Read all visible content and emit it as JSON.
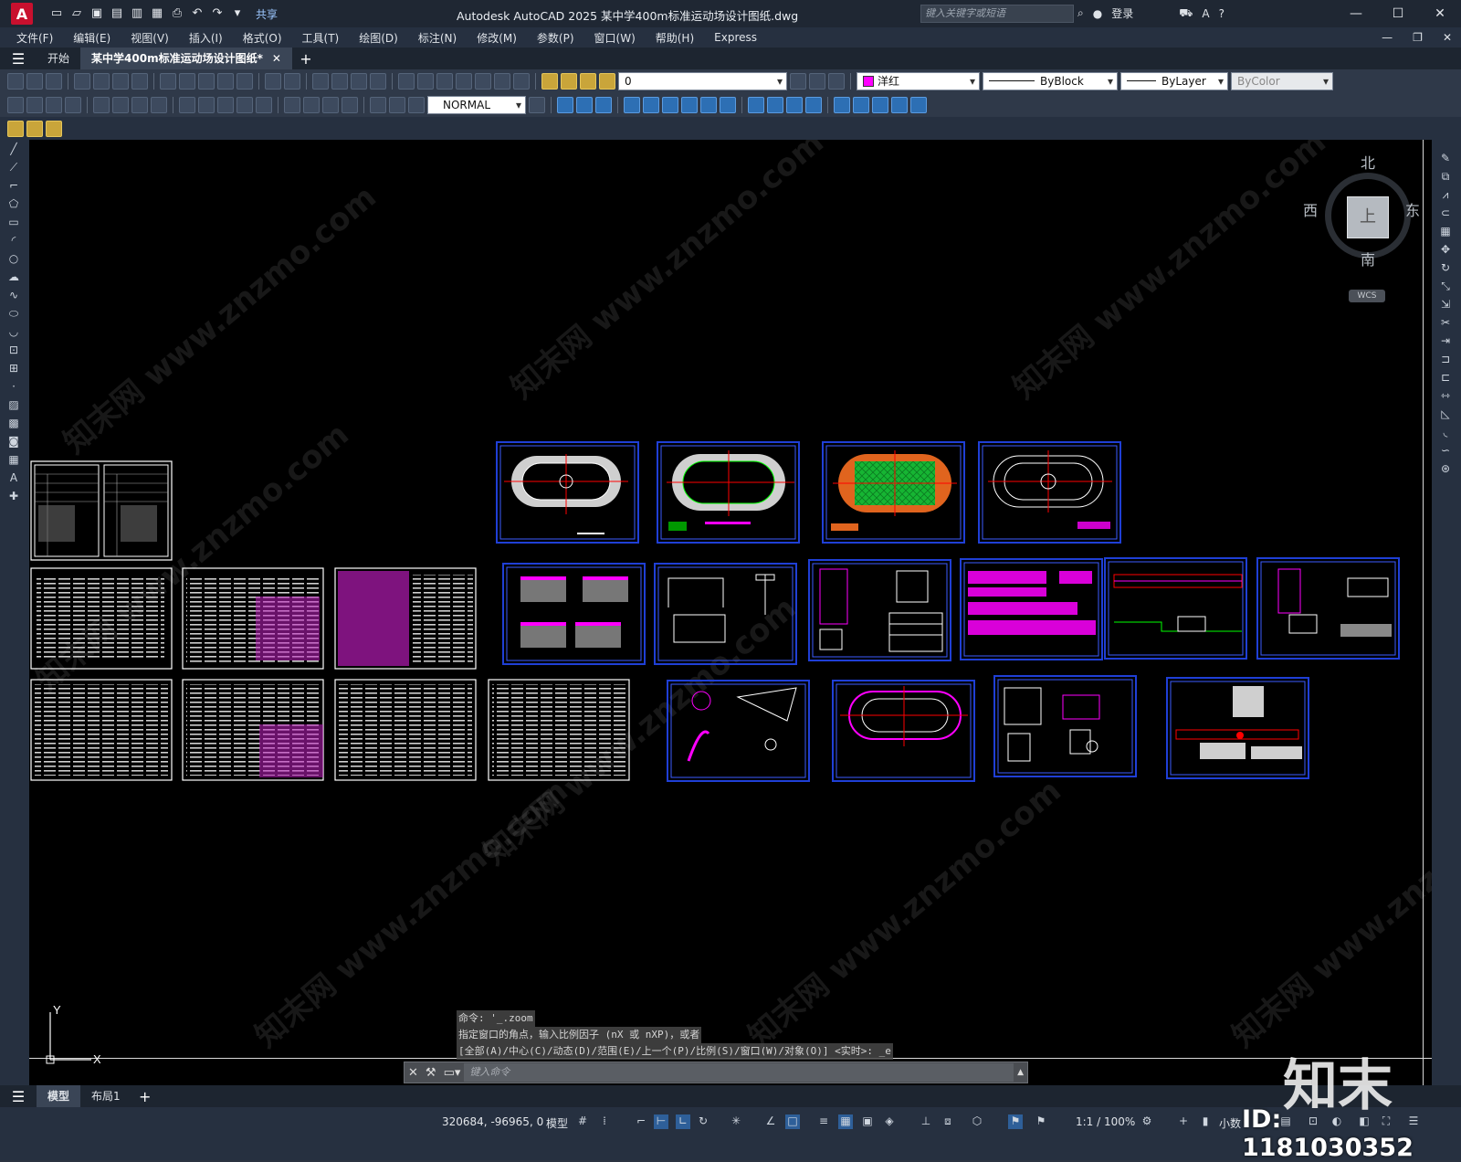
{
  "app": {
    "title": "Autodesk AutoCAD 2025    某中学400m标准运动场设计图纸.dwg",
    "search_placeholder": "键入关键字或短语",
    "login": "登录",
    "share": "共享"
  },
  "menu": [
    "文件(F)",
    "编辑(E)",
    "视图(V)",
    "插入(I)",
    "格式(O)",
    "工具(T)",
    "绘图(D)",
    "标注(N)",
    "修改(M)",
    "参数(P)",
    "窗口(W)",
    "帮助(H)",
    "Express"
  ],
  "tabs": {
    "start": "开始",
    "drawing": "某中学400m标准运动场设计图纸*"
  },
  "toolbar": {
    "layer": "0",
    "color_value": "洋红",
    "color_hex": "#ff00ff",
    "linetype": "ByBlock",
    "lineweight": "ByLayer",
    "plotstyle": "ByColor",
    "dimstyle": "NORMAL"
  },
  "viewcube": {
    "north": "北",
    "south": "南",
    "east": "东",
    "west": "西",
    "top": "上",
    "wcs": "WCS"
  },
  "ucs": {
    "x": "X",
    "y": "Y"
  },
  "command_history": [
    "命令: '_.zoom",
    "指定窗口的角点，输入比例因子 (nX 或 nXP)，或者",
    "[全部(A)/中心(C)/动态(D)/范围(E)/上一个(P)/比例(S)/窗口(W)/对象(O)] <实时>: _e"
  ],
  "command_placeholder": "键入命令",
  "layout_tabs": {
    "model": "模型",
    "layout1": "布局1"
  },
  "status": {
    "coords": "320684, -96965, 0",
    "model": "模型",
    "scale": "1:1 / 100%",
    "units": "小数"
  },
  "watermark": {
    "brand": "知末",
    "id": "ID: 1181030352",
    "site": "知末网 www.znzmo.com"
  },
  "colors": {
    "canvas": "#000000",
    "frame_blue": "#1f3fd6",
    "magenta": "#ff00ff",
    "track_orange": "#e0641e",
    "field_green": "#16b533"
  }
}
